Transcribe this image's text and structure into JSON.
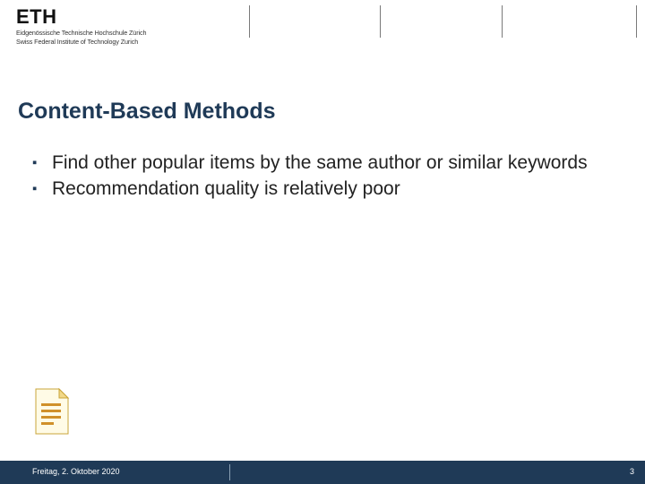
{
  "logo": {
    "name": "ETH",
    "sub1": "Eidgenössische Technische Hochschule Zürich",
    "sub2": "Swiss Federal Institute of Technology Zurich"
  },
  "title": "Content-Based Methods",
  "bullets": [
    "Find other popular items by the same author or similar keywords",
    "Recommendation quality is relatively poor"
  ],
  "footer": {
    "date": "Freitag, 2. Oktober 2020",
    "page": "3"
  }
}
